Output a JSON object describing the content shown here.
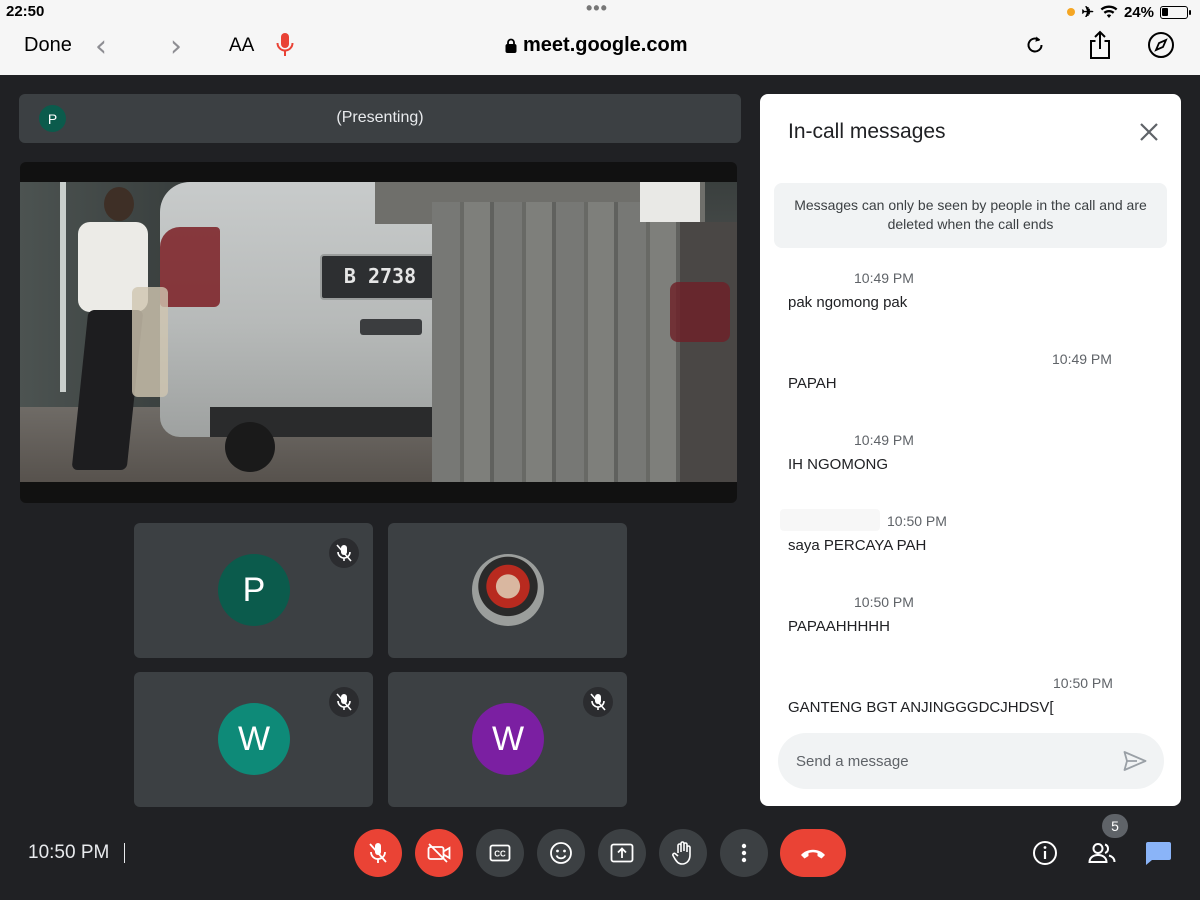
{
  "status_bar": {
    "time": "22:50",
    "battery": "24%"
  },
  "browser": {
    "done_label": "Done",
    "url": "meet.google.com",
    "text_size_label": "AA"
  },
  "presenter": {
    "initial": "P",
    "label": "(Presenting)"
  },
  "presented_video": {
    "plate_text": "B 2738"
  },
  "tiles": [
    {
      "initial": "P",
      "color": "#0b5b4c",
      "muted": true
    },
    {
      "initial": "",
      "color": "#8a3b2a",
      "muted": false,
      "photo": true
    },
    {
      "initial": "W",
      "color": "#0e8a78",
      "muted": true
    },
    {
      "initial": "W",
      "color": "#7b1fa2",
      "muted": true
    }
  ],
  "chat": {
    "title": "In-call messages",
    "notice": "Messages can only be seen by people in the call and are deleted when the call ends",
    "messages": [
      {
        "time": "10:49 PM",
        "text": "pak ngomong pak"
      },
      {
        "time": "10:49 PM",
        "text": "PAPAH"
      },
      {
        "time": "10:49 PM",
        "text": "IH NGOMONG"
      },
      {
        "time": "10:50 PM",
        "text": "saya PERCAYA PAH"
      },
      {
        "time": "10:50 PM",
        "text": "PAPAAHHHHH"
      },
      {
        "time": "10:50 PM",
        "text": "GANTENG BGT ANJINGGGDCJHDSV["
      }
    ],
    "input_placeholder": "Send a message"
  },
  "bottom": {
    "time": "10:50 PM",
    "participant_count": "5"
  },
  "colors": {
    "danger": "#ea4335",
    "chat_accent": "#1a73e8"
  }
}
